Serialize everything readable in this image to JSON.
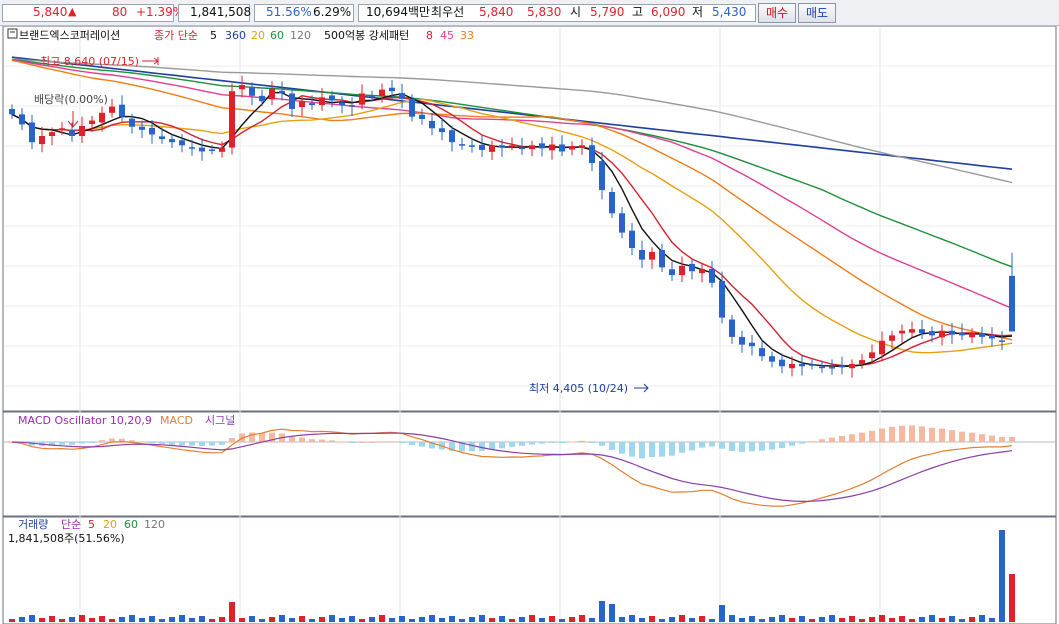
{
  "quote": {
    "price": "5,840",
    "change_arrow": "▲",
    "change": "80",
    "change_pct": "+1.39%",
    "volume": "1,841,508",
    "volume_ratio": "51.56%",
    "turnover": "6.29%",
    "trade_value": "10,694백만",
    "best_ask_label": "최우선",
    "best_ask": "5,840",
    "best_bid": "5,830",
    "open_label": "시",
    "open": "5,790",
    "high_label": "고",
    "high": "6,090",
    "low_label": "저",
    "low": "5,430"
  },
  "buttons": {
    "buy": "매수",
    "sell": "매도"
  },
  "colors": {
    "up": "#e0212b",
    "down": "#2a63c9",
    "ma5": "#111111",
    "ma360": "#1e3fa0",
    "ma20": "#e8a010",
    "ma60": "#1e8f3a",
    "ma120": "#9a9a9a",
    "strong8": "#d4232e",
    "strong45": "#e0408f",
    "strong33": "#f07c1a",
    "macd": "#e37f33",
    "signal": "#8a3fa8",
    "osc_pos": "#f5b8a0",
    "osc_neg": "#9ed7ef"
  },
  "legend": {
    "title_icon": "chart-settings-icon",
    "stock": "브랜드엑스코퍼레이션",
    "ma_group": "종가 단순",
    "ma_p1": "5",
    "ma_p2": "360",
    "ma_p3": "20",
    "ma_p4": "60",
    "ma_p5": "120",
    "pattern": "500억봉 강세패턴",
    "pat_p1": "8",
    "pat_p2": "45",
    "pat_p3": "33"
  },
  "annotations": {
    "high": "최고 8,640 (07/15)",
    "low": "최저 4,405 (10/24)",
    "dividend": "배당락(0.00%)"
  },
  "macd_legend": {
    "osc": "MACD Oscillator 10,20,9",
    "macd": "MACD",
    "signal": "시그널"
  },
  "volume_legend": {
    "label": "거래량",
    "group": "단순",
    "p1": "5",
    "p2": "20",
    "p3": "60",
    "p4": "120",
    "current": "1,841,508주(51.56%)"
  },
  "chart_data": {
    "type": "candlestick",
    "series_count": 101,
    "price_levels": {
      "high": 8640,
      "low": 4405,
      "last_open": 5790,
      "last_high": 6090,
      "last_low": 5430,
      "last_close": 5840
    },
    "close": [
      7880,
      7750,
      7520,
      7600,
      7650,
      7700,
      7600,
      7730,
      7800,
      7900,
      7980,
      7850,
      7720,
      7680,
      7620,
      7560,
      7520,
      7480,
      7450,
      7400,
      7420,
      7450,
      8180,
      8260,
      8120,
      8050,
      8210,
      8150,
      7950,
      8050,
      8000,
      8100,
      8060,
      8000,
      7980,
      8150,
      8120,
      8200,
      8180,
      8080,
      7850,
      7820,
      7700,
      7650,
      7520,
      7480,
      7460,
      7420,
      7480,
      7450,
      7480,
      7430,
      7480,
      7440,
      7490,
      7400,
      7470,
      7480,
      7250,
      6900,
      6600,
      6350,
      6150,
      6000,
      6100,
      5900,
      5800,
      5920,
      5850,
      5880,
      5700,
      5250,
      5000,
      4900,
      4880,
      4750,
      4680,
      4620,
      4650,
      4620,
      4640,
      4610,
      4600,
      4620,
      4650,
      4700,
      4800,
      4950,
      5020,
      5080,
      5100,
      5050,
      5020,
      5080,
      5030,
      5020,
      5050,
      5000,
      4980,
      4950,
      5070
    ],
    "ma_lines": [
      "ma5",
      "ma20",
      "ma60",
      "ma120",
      "ma360",
      "strong8",
      "strong45",
      "strong33"
    ],
    "macd_range": [
      -900,
      300
    ],
    "volume_last": 1841508,
    "volume_last_ratio_pct": 51.56
  }
}
